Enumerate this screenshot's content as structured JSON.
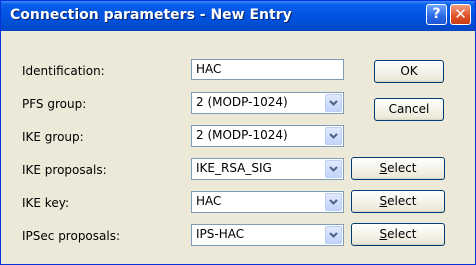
{
  "window": {
    "title": "Connection parameters - New Entry"
  },
  "titlebar": {
    "help_glyph": "?",
    "close_glyph": "✕"
  },
  "fields": {
    "identification": {
      "label": "Identification:",
      "value": "HAC"
    },
    "pfs_group": {
      "label": "PFS group:",
      "value": "2 (MODP-1024)"
    },
    "ike_group": {
      "label": "IKE group:",
      "value": "2 (MODP-1024)"
    },
    "ike_proposals": {
      "label": "IKE proposals:",
      "value": "IKE_RSA_SIG"
    },
    "ike_key": {
      "label": "IKE key:",
      "value": "HAC"
    },
    "ipsec_proposals": {
      "label": "IPSec proposals:",
      "value": "IPS-HAC"
    }
  },
  "buttons": {
    "ok": "OK",
    "cancel": "Cancel",
    "select_accel": "S",
    "select_rest": "elect"
  },
  "colors": {
    "dialog_bg": "#ECE9D8",
    "titlebar": "#0054E3",
    "field_border": "#7F9DB9"
  }
}
